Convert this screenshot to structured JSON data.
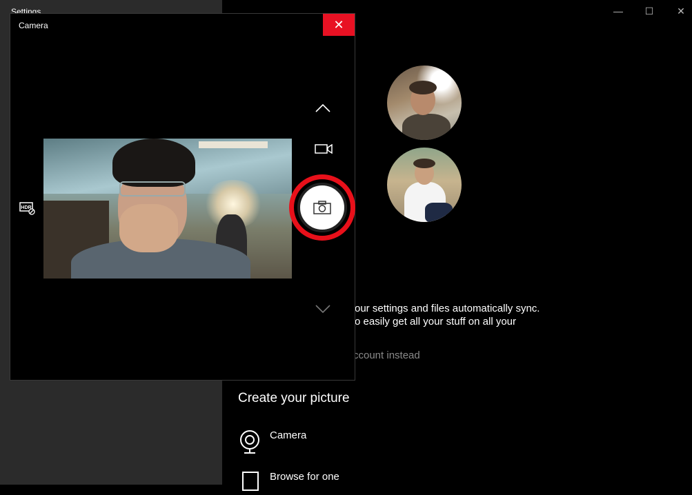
{
  "settings": {
    "title": "Settings",
    "window_controls": {
      "minimize": "—",
      "maximize": "☐",
      "close": "✕"
    },
    "sync_line1": "our settings and files automatically sync.",
    "sync_line2": "o easily get all your stuff on all your",
    "link": "ccount instead",
    "create_title": "Create your picture",
    "options": [
      {
        "label": "Camera",
        "icon": "webcam-icon"
      },
      {
        "label": "Browse for one",
        "icon": "browse-icon"
      }
    ]
  },
  "camera": {
    "title": "Camera",
    "close_label": "✕",
    "hdr_label": "HDR",
    "accent": "#e81123",
    "highlight": "#e8101a"
  }
}
